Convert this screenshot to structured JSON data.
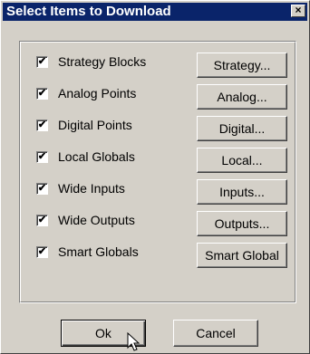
{
  "dialog": {
    "title": "Select Items to Download",
    "close_label": "×"
  },
  "items": [
    {
      "label": "Strategy Blocks",
      "checked": true,
      "button": "Strategy..."
    },
    {
      "label": "Analog Points",
      "checked": true,
      "button": "Analog..."
    },
    {
      "label": "Digital Points",
      "checked": true,
      "button": "Digital..."
    },
    {
      "label": "Local Globals",
      "checked": true,
      "button": "Local..."
    },
    {
      "label": "Wide Inputs",
      "checked": true,
      "button": "Inputs..."
    },
    {
      "label": "Wide Outputs",
      "checked": true,
      "button": "Outputs..."
    },
    {
      "label": "Smart Globals",
      "checked": true,
      "button": "Smart Global"
    }
  ],
  "check_mark": "✔",
  "footer": {
    "ok_label": "Ok",
    "cancel_label": "Cancel"
  },
  "colors": {
    "titlebar": "#0a246a",
    "face": "#d4d0c8"
  },
  "icons": {
    "cursor": "arrow-pointer-icon"
  }
}
